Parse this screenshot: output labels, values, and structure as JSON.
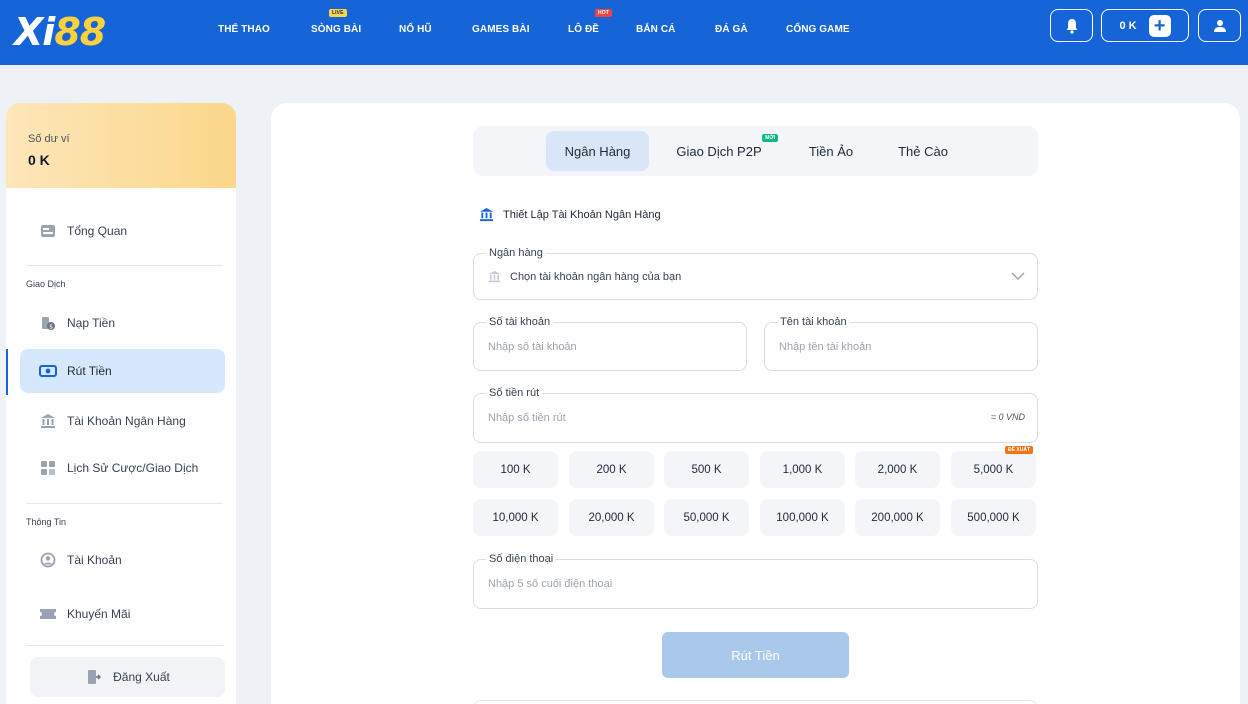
{
  "header": {
    "logo_text_x": "Xi",
    "logo_text_num": "88",
    "nav": [
      {
        "label": "THỂ THAO"
      },
      {
        "label": "SÒNG BÀI",
        "badge": "LIVE"
      },
      {
        "label": "NỔ HŨ"
      },
      {
        "label": "GAMES BÀI"
      },
      {
        "label": "LÔ ĐỀ",
        "badge": "HOT"
      },
      {
        "label": "BẮN CÁ"
      },
      {
        "label": "ĐÁ GÀ"
      },
      {
        "label": "CỔNG GAME"
      }
    ],
    "balance": "0 K",
    "icons": {
      "bell": "bell-icon",
      "add": "plus-icon",
      "user": "user-icon"
    }
  },
  "sidebar": {
    "wallet_label": "Số dư ví",
    "wallet_value": "0 K",
    "overview": "Tổng Quan",
    "section_transactions": "Giao Dịch",
    "deposit": "Nạp Tiền",
    "withdraw": "Rút Tiền",
    "bank_account": "Tài Khoản Ngân Hàng",
    "history": "Lịch Sử Cược/Giao Dịch",
    "section_info": "Thông Tin",
    "account": "Tài Khoản",
    "promotions": "Khuyến Mãi",
    "logout": "Đăng Xuất"
  },
  "main": {
    "tabs": [
      {
        "label": "Ngân Hàng",
        "active": true
      },
      {
        "label": "Giao Dịch P2P",
        "badge": "MỚI"
      },
      {
        "label": "Tiền Ảo"
      },
      {
        "label": "Thẻ Cào"
      }
    ],
    "section_title": "Thiết Lập Tài Khoản Ngân Hàng",
    "bank_label": "Ngân hàng",
    "bank_placeholder": "Chọn tài khoản ngân hàng của bạn",
    "account_number_label": "Số tài khoản",
    "account_number_placeholder": "Nhập số tài khoản",
    "account_name_label": "Tên tài khoản",
    "account_name_placeholder": "Nhập tên tài khoản",
    "amount_label": "Số tiền rút",
    "amount_placeholder": "Nhập số tiền rút",
    "amount_conversion": "= 0 VND",
    "amount_options": [
      "100 K",
      "200 K",
      "500 K",
      "1,000 K",
      "2,000 K",
      "5,000 K",
      "10,000 K",
      "20,000 K",
      "50,000 K",
      "100,000 K",
      "200,000 K",
      "500,000 K"
    ],
    "recommended_badge": "ĐỀ XUẤT",
    "phone_label": "Số điện thoại",
    "phone_placeholder": "Nhập 5 số cuối điện thoại",
    "submit": "Rút Tiền"
  },
  "colors": {
    "brand": "#1565d8",
    "wallet": "#fbd78b",
    "active": "#d6e8fb",
    "submit": "#a9c8ea"
  }
}
